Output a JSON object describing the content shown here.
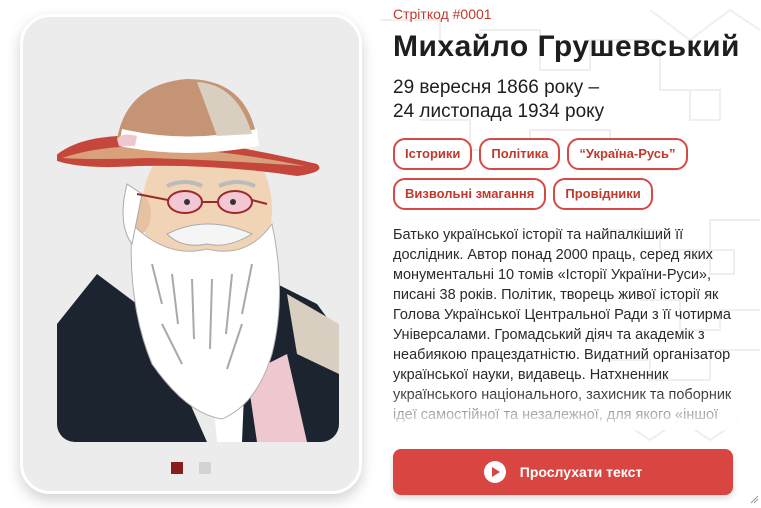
{
  "person": {
    "code": "Стріткод #0001",
    "name": "Михайло Грушевський",
    "date_line1": "29 вересня 1866 року –",
    "date_line2": "24 листопада 1934 року"
  },
  "tags": [
    "Історики",
    "Політика",
    "“Україна-Русь”",
    "Визвольні змагання",
    "Провідники"
  ],
  "bio": "Батько української історії та найпалкіший її дослідник. Автор понад 2000 праць, серед яких монументальні 10 томів «Історії України-Руси», писані 38 років. Політик, творець живої історії як Голова Української Центральної Ради з її чотирма Універсалами. Громадський діяч та академік з неабиякою працездатністю. Видатний організатор української науки, видавець. Натхненник українського національного, захисник та поборник ідеї самостійної та незалежної, для якого «іншої",
  "listen_button": "Прослухати текст",
  "carousel": {
    "total": 2,
    "active": 0
  },
  "colors": {
    "accent": "#d94540",
    "dark_red": "#8b1c1c",
    "card_bg": "#ececec"
  }
}
